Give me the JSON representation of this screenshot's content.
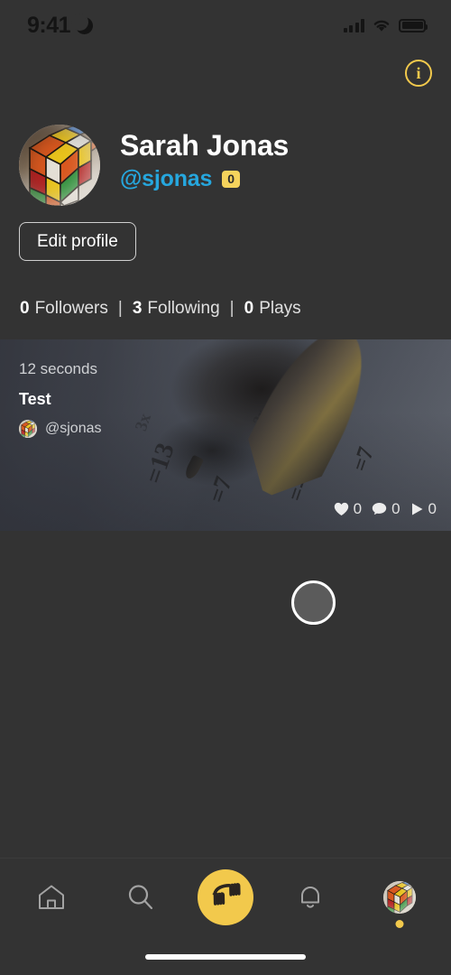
{
  "status_bar": {
    "time": "9:41",
    "dnd_icon": "moon-icon",
    "signal_icon": "cellular-signal-icon",
    "wifi_icon": "wifi-icon",
    "battery_icon": "battery-icon"
  },
  "header": {
    "info_label": "i",
    "info_icon": "info-circle-icon",
    "accent_color": "#f2c94c"
  },
  "profile": {
    "avatar_icon": "user-avatar-rubiks-cube",
    "name": "Sarah Jonas",
    "handle": "@sjonas",
    "handle_color": "#26a7de",
    "score_badge": "0",
    "badge_color": "#f5d35c",
    "edit_button": "Edit profile"
  },
  "stats": {
    "followers_count": "0",
    "followers_label": "Followers",
    "following_count": "3",
    "following_label": "Following",
    "plays_count": "0",
    "plays_label": "Plays",
    "separator": "|"
  },
  "post": {
    "duration": "12 seconds",
    "title": "Test",
    "author_handle": "@sjonas",
    "author_avatar_icon": "author-avatar-rubiks-cube",
    "likes": "0",
    "comments": "0",
    "plays": "0",
    "like_icon": "heart-icon",
    "comment_icon": "comment-bubble-icon",
    "play_icon": "play-triangle-icon"
  },
  "loading": {
    "spinner_icon": "loading-spinner-circle"
  },
  "nav": {
    "home_icon": "home-icon",
    "search_icon": "search-icon",
    "create_icon": "wave-logo-icon",
    "notifications_icon": "bell-icon",
    "profile_icon": "profile-avatar-icon",
    "active_indicator": "active-tab-dot"
  },
  "system": {
    "home_indicator": "home-indicator-bar"
  }
}
